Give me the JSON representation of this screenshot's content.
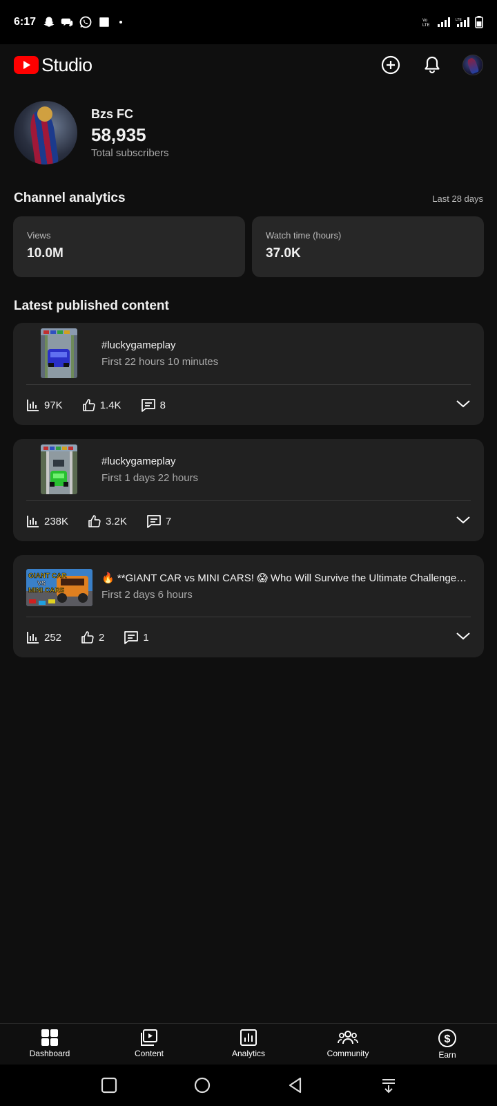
{
  "status_bar": {
    "time": "6:17",
    "left_icons": [
      "snapchat-icon",
      "chat-bubble-icon",
      "whatsapp-icon",
      "square-notification-icon",
      "dot-icon"
    ],
    "right_icons": [
      "volte-icon",
      "signal-icon",
      "lte-signal-icon",
      "battery-icon"
    ]
  },
  "header": {
    "logo_text": "Studio",
    "brand_color": "#ff0000"
  },
  "channel": {
    "name": "Bzs FC",
    "subscriber_count": "58,935",
    "subscriber_label": "Total subscribers"
  },
  "analytics": {
    "title": "Channel analytics",
    "period": "Last 28 days",
    "metrics": [
      {
        "label": "Views",
        "value": "10.0M"
      },
      {
        "label": "Watch time (hours)",
        "value": "37.0K"
      }
    ]
  },
  "latest": {
    "title": "Latest published content",
    "items": [
      {
        "title": "#luckygameplay",
        "subtitle": "First 22 hours 10 minutes",
        "views": "97K",
        "likes": "1.4K",
        "comments": "8",
        "thumb_type": "short"
      },
      {
        "title": "#luckygameplay",
        "subtitle": "First 1 days 22 hours",
        "views": "238K",
        "likes": "3.2K",
        "comments": "7",
        "thumb_type": "short"
      },
      {
        "title": "🔥 **GIANT CAR vs MINI CARS! 😱 Who Will Survive the Ultimate Challenge? …",
        "subtitle": "First 2 days 6 hours",
        "views": "252",
        "likes": "2",
        "comments": "1",
        "thumb_type": "wide",
        "thumb_text": [
          "GIANT CAR",
          "VS",
          "MINI CARS"
        ]
      }
    ]
  },
  "bottom_nav": {
    "items": [
      {
        "label": "Dashboard",
        "icon": "dashboard-icon"
      },
      {
        "label": "Content",
        "icon": "content-icon"
      },
      {
        "label": "Analytics",
        "icon": "analytics-icon"
      },
      {
        "label": "Community",
        "icon": "community-icon"
      },
      {
        "label": "Earn",
        "icon": "earn-icon"
      }
    ]
  }
}
